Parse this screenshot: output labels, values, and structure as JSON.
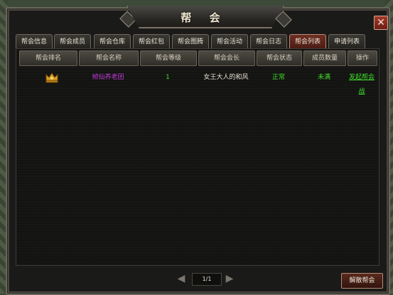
{
  "window": {
    "title": "帮 会",
    "close_label": "✕"
  },
  "tabs": [
    {
      "label": "帮会信息",
      "active": false
    },
    {
      "label": "帮会成员",
      "active": false
    },
    {
      "label": "帮会仓库",
      "active": false
    },
    {
      "label": "帮会红包",
      "active": false
    },
    {
      "label": "帮会图腾",
      "active": false
    },
    {
      "label": "帮会活动",
      "active": false
    },
    {
      "label": "帮会日志",
      "active": false
    },
    {
      "label": "帮会列表",
      "active": true
    },
    {
      "label": "申请列表",
      "active": false
    }
  ],
  "table": {
    "headers": [
      "帮会排名",
      "帮会名称",
      "帮会等级",
      "帮会会长",
      "帮会状态",
      "成员数量",
      "操作"
    ],
    "rows": [
      {
        "rank_icon": "crown-icon",
        "name": "倾仙养老团",
        "level": "1",
        "leader": "女王大人的和风",
        "status": "正常",
        "members": "未满",
        "action": "发起帮会战"
      }
    ]
  },
  "pager": {
    "page": "1/1",
    "prev_icon": "arrow-left-icon",
    "next_icon": "arrow-right-icon"
  },
  "footer": {
    "dissolve_label": "解散帮会"
  },
  "colors": {
    "name": "#c03ad6",
    "level": "#3fdc2a",
    "leader": "#e8e2d2",
    "status": "#3fdc2a",
    "members": "#3fdc2a",
    "action": "#3fdc2a",
    "active_tab": "#6e2e22"
  }
}
